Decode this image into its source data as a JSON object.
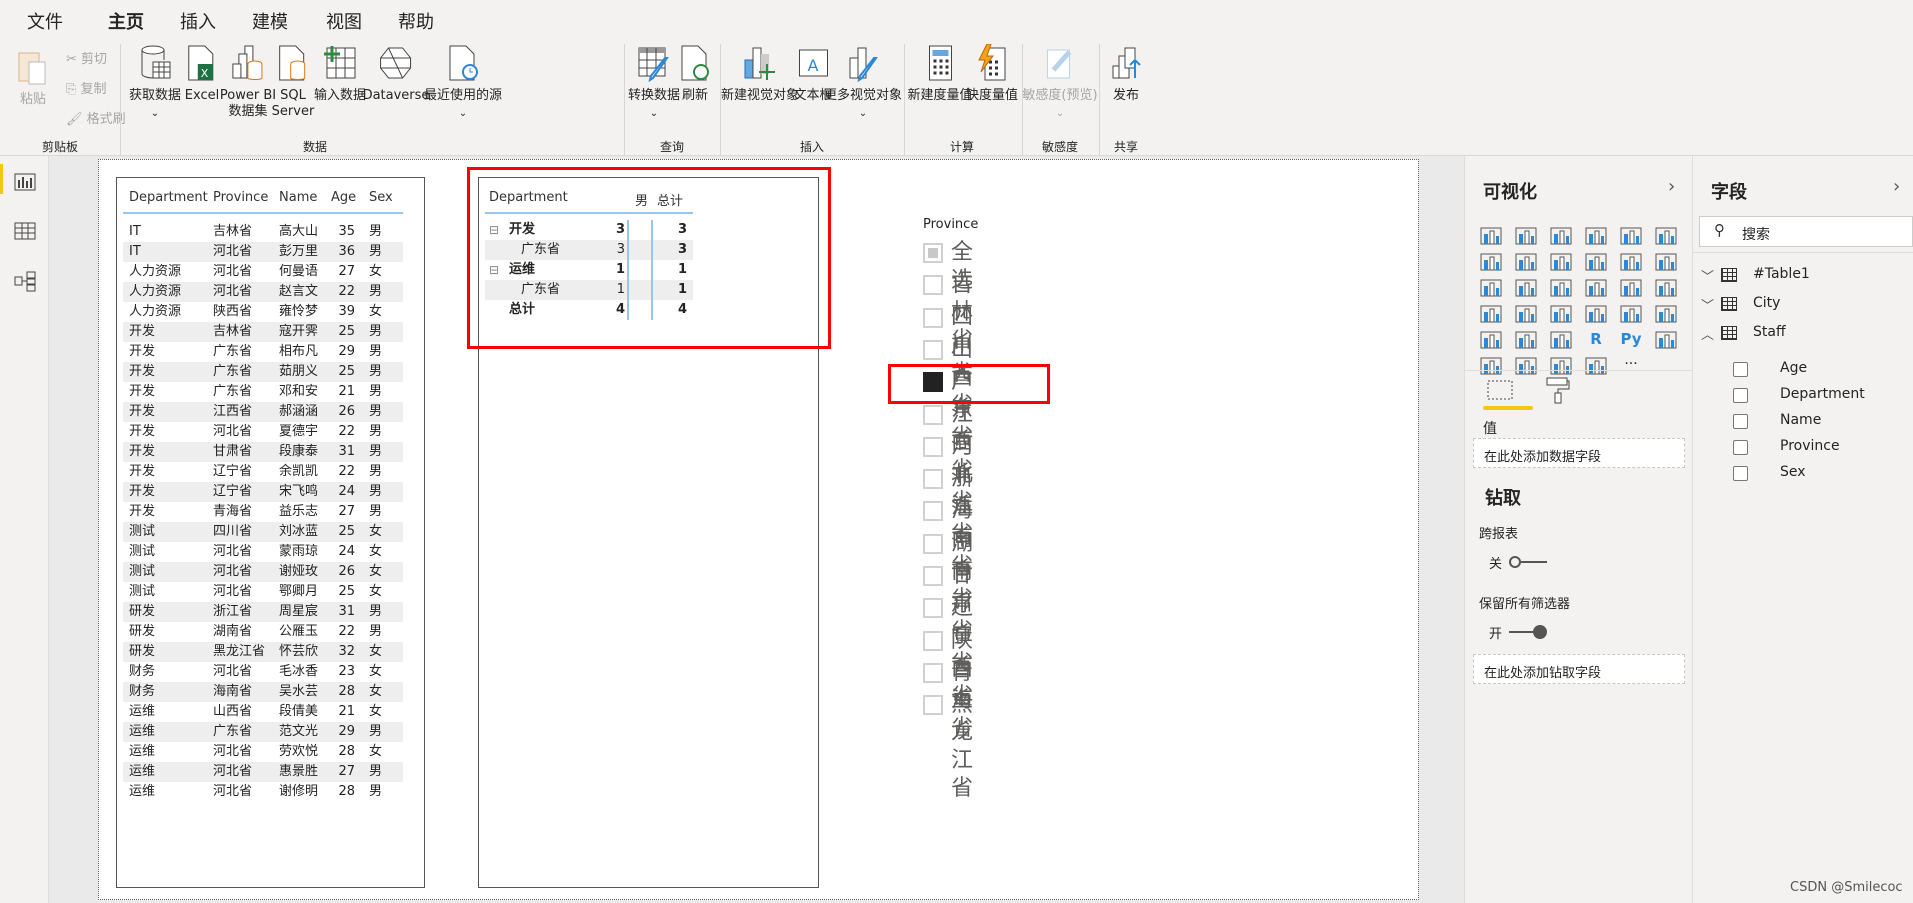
{
  "tabs": [
    "文件",
    "主页",
    "插入",
    "建模",
    "视图",
    "帮助"
  ],
  "active_tab": "主页",
  "ribbon": {
    "clipboard": {
      "paste": "粘贴",
      "cut": "剪切",
      "copy": "复制",
      "format_painter": "格式刷",
      "group": "剪贴板"
    },
    "data": {
      "get_data": "获取数据",
      "excel": "Excel",
      "pbi_1": "Power BI",
      "pbi_2": "数据集",
      "sql_1": "SQL",
      "sql_2": "Server",
      "enter_data": "输入数据",
      "dataverse": "Dataverse",
      "recent": "最近使用的源",
      "group": "数据"
    },
    "queries": {
      "transform": "转换数据",
      "refresh": "刷新",
      "group": "查询"
    },
    "insert": {
      "new_visual": "新建视觉对象",
      "textbox": "文本框",
      "more_visuals": "更多视觉对象",
      "group": "插入"
    },
    "calc": {
      "new_measure": "新建度量值",
      "quick_measure": "快度量值",
      "group": "计算"
    },
    "sensitivity": {
      "label": "敏感度(预览)",
      "group": "敏感度"
    },
    "share": {
      "publish": "发布",
      "group": "共享"
    }
  },
  "table": {
    "columns": [
      "Department",
      "Province",
      "Name",
      "Age",
      "Sex"
    ],
    "rows": [
      [
        "IT",
        "吉林省",
        "高大山",
        "35",
        "男"
      ],
      [
        "IT",
        "河北省",
        "彭万里",
        "36",
        "男"
      ],
      [
        "人力资源",
        "河北省",
        "何曼语",
        "27",
        "女"
      ],
      [
        "人力资源",
        "河北省",
        "赵言文",
        "22",
        "男"
      ],
      [
        "人力资源",
        "陕西省",
        "雍怜梦",
        "39",
        "女"
      ],
      [
        "开发",
        "吉林省",
        "寇开霁",
        "25",
        "男"
      ],
      [
        "开发",
        "广东省",
        "相布凡",
        "29",
        "男"
      ],
      [
        "开发",
        "广东省",
        "茹朋义",
        "25",
        "男"
      ],
      [
        "开发",
        "广东省",
        "邓和安",
        "21",
        "男"
      ],
      [
        "开发",
        "江西省",
        "郝涵涵",
        "26",
        "男"
      ],
      [
        "开发",
        "河北省",
        "夏德宇",
        "22",
        "男"
      ],
      [
        "开发",
        "甘肃省",
        "段康泰",
        "31",
        "男"
      ],
      [
        "开发",
        "辽宁省",
        "余凯凯",
        "22",
        "男"
      ],
      [
        "开发",
        "辽宁省",
        "宋飞鸣",
        "24",
        "男"
      ],
      [
        "开发",
        "青海省",
        "益乐志",
        "27",
        "男"
      ],
      [
        "测试",
        "四川省",
        "刘冰蓝",
        "25",
        "女"
      ],
      [
        "测试",
        "河北省",
        "蒙雨琼",
        "24",
        "女"
      ],
      [
        "测试",
        "河北省",
        "谢娅玫",
        "26",
        "女"
      ],
      [
        "测试",
        "河北省",
        "鄂卿月",
        "25",
        "女"
      ],
      [
        "研发",
        "浙江省",
        "周星宸",
        "31",
        "男"
      ],
      [
        "研发",
        "湖南省",
        "公雁玉",
        "22",
        "男"
      ],
      [
        "研发",
        "黑龙江省",
        "怀芸欣",
        "32",
        "女"
      ],
      [
        "财务",
        "河北省",
        "毛冰香",
        "23",
        "女"
      ],
      [
        "财务",
        "海南省",
        "吴水芸",
        "28",
        "女"
      ],
      [
        "运维",
        "山西省",
        "段倩美",
        "21",
        "女"
      ],
      [
        "运维",
        "广东省",
        "范文光",
        "29",
        "男"
      ],
      [
        "运维",
        "河北省",
        "劳欢悦",
        "28",
        "女"
      ],
      [
        "运维",
        "河北省",
        "惠景胜",
        "27",
        "男"
      ],
      [
        "运维",
        "河北省",
        "谢修明",
        "28",
        "男"
      ]
    ]
  },
  "matrix": {
    "header": {
      "dept": "Department",
      "male": "男",
      "total": "总计"
    },
    "rows": [
      {
        "label": "开发",
        "male": "3",
        "total": "3",
        "level": 0
      },
      {
        "label": "广东省",
        "male": "3",
        "total": "3",
        "level": 1
      },
      {
        "label": "运维",
        "male": "1",
        "total": "1",
        "level": 0
      },
      {
        "label": "广东省",
        "male": "1",
        "total": "1",
        "level": 1
      },
      {
        "label": "总计",
        "male": "4",
        "total": "4",
        "level": 2
      }
    ]
  },
  "slicer": {
    "title": "Province",
    "items": [
      "全选",
      "吉林省",
      "四川省",
      "山西省",
      "广东省",
      "江西省",
      "河北省",
      "浙江省",
      "海南省",
      "湖南省",
      "甘肃省",
      "辽宁省",
      "陕西省",
      "青海省",
      "黑龙江省"
    ],
    "selected": "广东省"
  },
  "viz_pane": {
    "title": "可视化",
    "values_label": "值",
    "values_drop": "在此处添加数据字段",
    "drill_title": "钻取",
    "cross_report": "跨报表",
    "cross_report_state": "关",
    "keep_filters": "保留所有筛选器",
    "keep_filters_state": "开",
    "drill_drop": "在此处添加钻取字段",
    "r_label": "R",
    "py_label": "Py",
    "more": "···"
  },
  "fields_pane": {
    "title": "字段",
    "search_placeholder": "搜索",
    "tables": [
      {
        "name": "#Table1",
        "expanded": false
      },
      {
        "name": "City",
        "expanded": false
      },
      {
        "name": "Staff",
        "expanded": true
      }
    ],
    "staff_fields": [
      "Age",
      "Department",
      "Name",
      "Province",
      "Sex"
    ]
  },
  "watermark": "CSDN @Smilecoc",
  "colors": {
    "accent": "#f2c811",
    "highlight": "#ff0000",
    "header_line": "#99c5ee",
    "visual_blue": "#2b88d8"
  }
}
